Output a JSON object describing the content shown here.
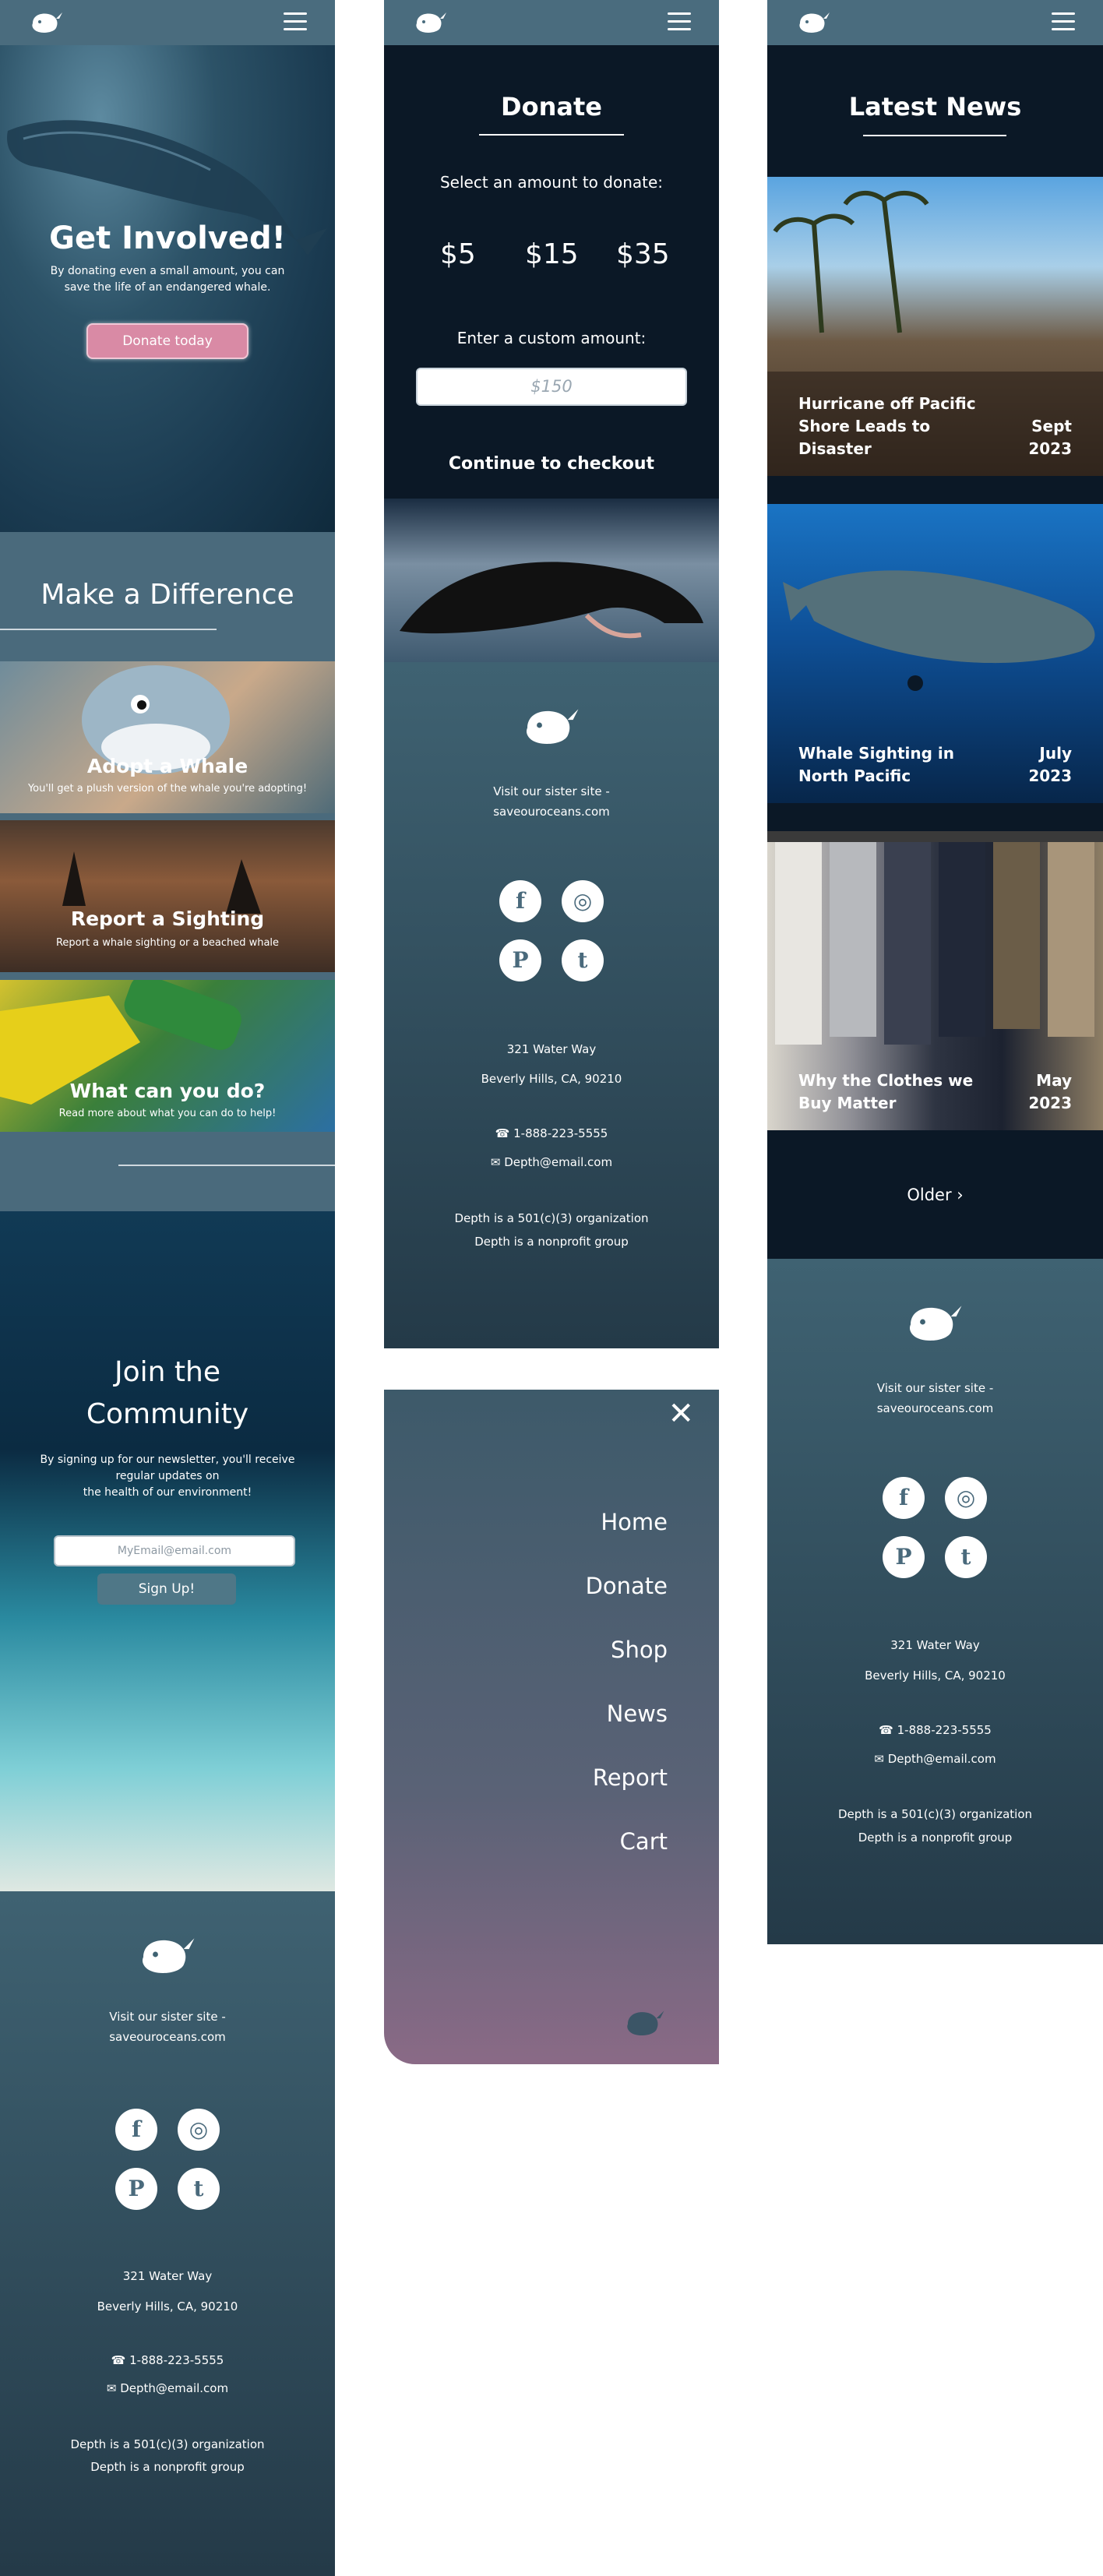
{
  "hero": {
    "title": "Get Involved!",
    "text": "By donating even a small amount, you can save the life of an endangered whale.",
    "button": "Donate today"
  },
  "difference": {
    "title": "Make a Difference",
    "cards": [
      {
        "title": "Adopt a Whale",
        "text": "You'll get a plush version of the whale you're adopting!"
      },
      {
        "title": "Report a Sighting",
        "text": "Report a whale sighting or a beached whale"
      },
      {
        "title": "What can you do?",
        "text": "Read more about what you can do to help!"
      }
    ]
  },
  "community": {
    "title_line1": "Join the",
    "title_line2": "Community",
    "text_line1": "By signing up for our newsletter, you'll receive",
    "text_line2": "regular updates on",
    "text_line3": "the health of our environment!",
    "email_placeholder": "MyEmail@email.com",
    "button": "Sign Up!"
  },
  "footer": {
    "sister_line1": "Visit our sister site -",
    "sister_line2": "saveouroceans.com",
    "address_line1": "321 Water Way",
    "address_line2": "Beverly Hills, CA, 90210",
    "phone": "1-888-223-5555",
    "email": "Depth@email.com",
    "org_line1": "Depth is a 501(c)(3) organization",
    "org_line2": "Depth is a nonprofit group",
    "social_icons": [
      "facebook-icon",
      "instagram-icon",
      "pinterest-icon",
      "twitter-icon"
    ]
  },
  "donate": {
    "title": "Donate",
    "select_label": "Select an amount to donate:",
    "amounts": [
      "$5",
      "$15",
      "$35"
    ],
    "custom_label": "Enter a custom amount:",
    "custom_placeholder": "$150",
    "checkout": "Continue to checkout"
  },
  "menu": {
    "close": "✕",
    "items": [
      "Home",
      "Donate",
      "Shop",
      "News",
      "Report",
      "Cart"
    ]
  },
  "news": {
    "title": "Latest News",
    "articles": [
      {
        "title": "Hurricane off Pacific Shore Leads to Disaster",
        "date_month": "Sept",
        "date_year": "2023"
      },
      {
        "title": "Whale Sighting in North Pacific",
        "date_month": "July",
        "date_year": "2023"
      },
      {
        "title": "Why the Clothes we Buy Matter",
        "date_month": "May",
        "date_year": "2023"
      }
    ],
    "older": "Older"
  },
  "colors": {
    "footer_top": "#3f6272",
    "footer_bottom": "#243a48",
    "topbar": "#4a6c7e",
    "dark_bg": "#0b1826",
    "pink_button": "#d98aa5"
  }
}
